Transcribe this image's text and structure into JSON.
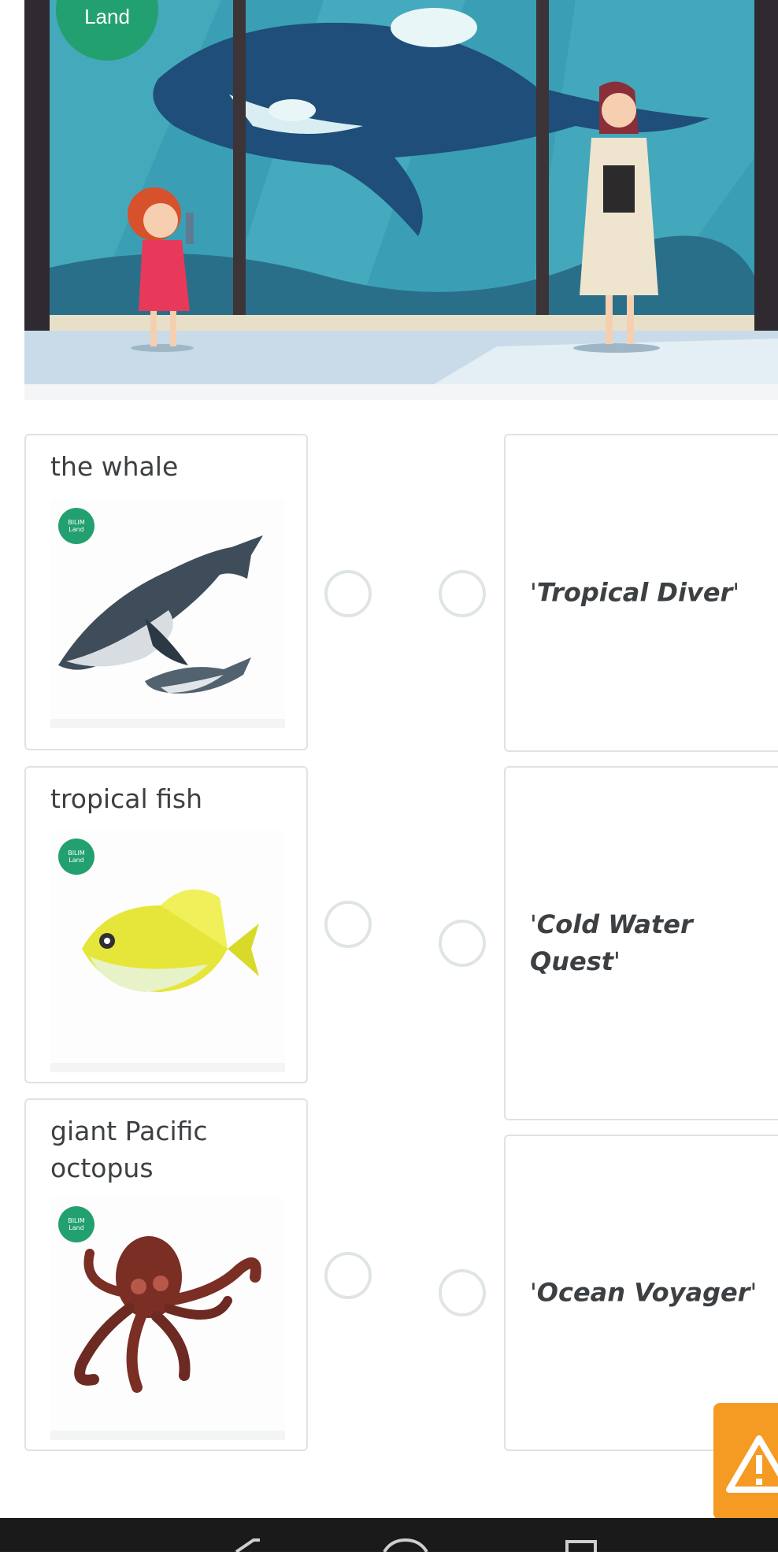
{
  "hero": {
    "brand_text": "Land"
  },
  "matching": {
    "left_items": [
      {
        "label": "the whale",
        "badge": "BILIM\nLand"
      },
      {
        "label": "tropical fish",
        "badge": "BILIM\nLand"
      },
      {
        "label": "giant Pacific octopus",
        "badge": "BILIM\nLand"
      }
    ],
    "right_items": [
      {
        "quote_open": "'",
        "title": "Tropical Diver",
        "quote_close": "'"
      },
      {
        "quote_open": "'",
        "title": "Cold Water Quest",
        "quote_close": "'"
      },
      {
        "quote_open": "'",
        "title": "Ocean Voyager",
        "quote_close": "'"
      }
    ]
  },
  "colors": {
    "accent_warning": "#f59a23",
    "brand_green": "#23a06f",
    "border": "#dde3e6"
  },
  "icons": {
    "warning": "warning-icon"
  }
}
